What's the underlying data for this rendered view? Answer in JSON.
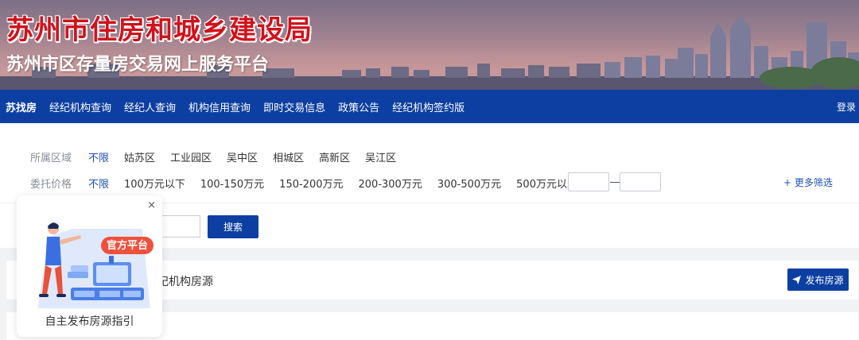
{
  "banner": {
    "title": "苏州市住房和城乡建设局",
    "subtitle": "苏州市区存量房交易网上服务平台"
  },
  "nav": {
    "items": [
      "苏找房",
      "经纪机构查询",
      "经纪人查询",
      "机构信用查询",
      "即时交易信息",
      "政策公告",
      "经纪机构签约版"
    ],
    "login": "登录"
  },
  "filters": {
    "region": {
      "label": "所属区域",
      "options": [
        "不限",
        "姑苏区",
        "工业园区",
        "吴中区",
        "相城区",
        "高新区",
        "吴江区"
      ],
      "selected": "不限"
    },
    "price": {
      "label": "委托价格",
      "options": [
        "不限",
        "100万元以下",
        "100-150万元",
        "150-200万元",
        "200-300万元",
        "300-500万元",
        "500万元以上"
      ],
      "selected": "不限",
      "min_value": "",
      "max_value": ""
    },
    "more": "+ 更多筛选"
  },
  "search": {
    "value": "",
    "button": "搜索"
  },
  "section": {
    "heading": "纪机构房源",
    "publish_button": "发布房源"
  },
  "guide": {
    "close": "×",
    "badge": "官方平台",
    "caption": "自主发布房源指引"
  },
  "colors": {
    "primary": "#0c3fa1",
    "title_red": "#d0121b",
    "active_link": "#1e50b4",
    "badge_red": "#f0503c"
  },
  "icons": {
    "publish": "paper-plane-icon",
    "close": "close-icon"
  }
}
